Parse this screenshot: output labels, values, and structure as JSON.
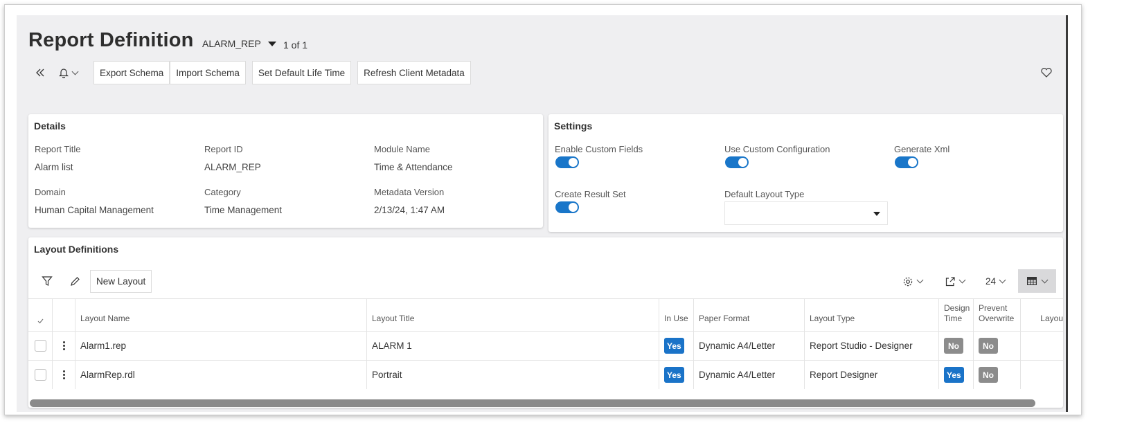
{
  "header": {
    "title": "Report Definition",
    "record_selector": "ALARM_REP",
    "record_count": "1 of 1"
  },
  "toolbar": {
    "buttons": [
      "Export Schema",
      "Import Schema",
      "Set Default Life Time",
      "Refresh Client Metadata"
    ],
    "icons": [
      "double-chevron-left-icon",
      "bell-icon",
      "chevron-down-icon",
      "heart-icon"
    ]
  },
  "details": {
    "heading": "Details",
    "fields": [
      {
        "label": "Report Title",
        "value": "Alarm list"
      },
      {
        "label": "Report ID",
        "value": "ALARM_REP"
      },
      {
        "label": "Module Name",
        "value": "Time & Attendance"
      },
      {
        "label": "Domain",
        "value": "Human Capital Management"
      },
      {
        "label": "Category",
        "value": "Time Management"
      },
      {
        "label": "Metadata Version",
        "value": "2/13/24, 1:47 AM"
      }
    ]
  },
  "settings": {
    "heading": "Settings",
    "toggles": [
      {
        "label": "Enable Custom Fields",
        "on": true
      },
      {
        "label": "Use Custom Configuration",
        "on": true
      },
      {
        "label": "Generate Xml",
        "on": true
      },
      {
        "label": "Create Result Set",
        "on": true
      }
    ],
    "default_layout_type": {
      "label": "Default Layout Type",
      "value": ""
    }
  },
  "layouts": {
    "heading": "Layout Definitions",
    "new_button": "New Layout",
    "page_size": "24",
    "icons": [
      "filter-icon",
      "pencil-icon",
      "gear-icon",
      "export-icon",
      "table-view-icon"
    ],
    "columns": [
      "Layout Name",
      "Layout Title",
      "In Use",
      "Paper Format",
      "Layout Type",
      "Design Time",
      "Prevent Overwrite",
      "Layou"
    ],
    "rows": [
      {
        "name": "Alarm1.rep",
        "title": "ALARM 1",
        "in_use": "Yes",
        "paper_format": "Dynamic A4/Letter",
        "layout_type": "Report Studio - Designer",
        "design_time": "No",
        "prevent_overwrite": "No"
      },
      {
        "name": "AlarmRep.rdl",
        "title": "Portrait",
        "in_use": "Yes",
        "paper_format": "Dynamic A4/Letter",
        "layout_type": "Report Designer",
        "design_time": "Yes",
        "prevent_overwrite": "No"
      }
    ]
  },
  "colors": {
    "accent": "#1a73c8",
    "badge_no": "#8c8c8c",
    "background": "#efeff1"
  }
}
